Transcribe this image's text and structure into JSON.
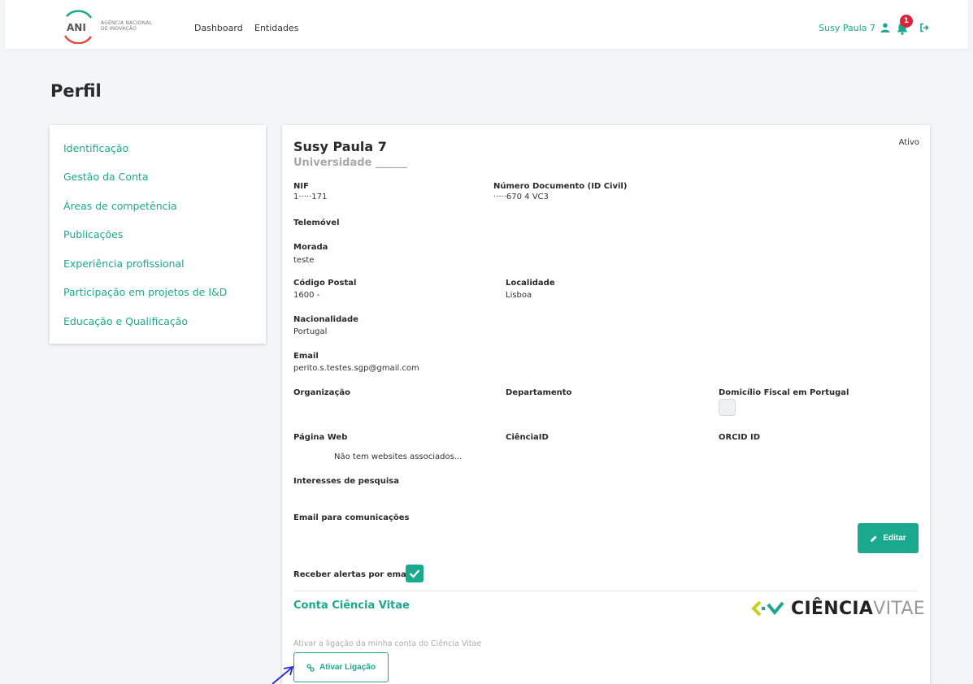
{
  "navbar": {
    "logo_text": "ANI",
    "logo_subtitle_line1": "AGÊNCIA NACIONAL",
    "logo_subtitle_line2": "DE INOVAÇÃO",
    "links": [
      "Dashboard",
      "Entidades"
    ],
    "user_name": "Susy Paula 7",
    "notification_count": "1",
    "icons": [
      "user-icon",
      "bell-icon",
      "logout-icon"
    ]
  },
  "page": {
    "title": "Perfil"
  },
  "menu": {
    "items": [
      "Identificação",
      "Gestão da Conta",
      "Áreas de competência",
      "Publicações",
      "Experiência profissional",
      "Participação em projetos de I&D",
      "Educação e Qualificação"
    ]
  },
  "profile": {
    "name": "Susy Paula 7",
    "organization": "Universidade ______",
    "status": "Ativo",
    "nif_label": "NIF",
    "nif_value": "1·····171",
    "doc_label": "Número Documento (ID Civil)",
    "doc_value": "·····670 4 VC3",
    "phone_label": "Telemóvel",
    "address_label": "Morada",
    "address_value": "teste",
    "postal_label": "Código Postal",
    "postal_value": "1600 -",
    "locality_label": "Localidade",
    "locality_value": "Lisboa",
    "nationality_label": "Nacionalidade",
    "nationality_value": "Portugal",
    "email_label": "Email",
    "email_value": "perito.s.testes.sgp@gmail.com",
    "organization_label": "Organização",
    "department_label": "Departamento",
    "tax_label": "Domicílio Fiscal em Portugal",
    "web_label": "Página Web",
    "web_empty": "Não tem websites associados...",
    "ciencia_label": "CiênciaID",
    "orcid_label": "ORCID ID",
    "interests_label": "Interesses de pesquisa",
    "comm_email_label": "Email para comunicações",
    "edit_button": "Editar",
    "alerts_label": "Receber alertas por email"
  },
  "ciencia_vitae": {
    "section_title": "Conta Ciência Vitae",
    "logo_bold": "CIÊNCIA",
    "logo_light": "VITAE",
    "hint": "Ativar a ligação da minha conta do Ciência Vitae",
    "button": "Ativar Ligação"
  },
  "colors": {
    "accent": "#1aa98e",
    "badge": "#d9243d",
    "logo_red": "#e04a3f"
  }
}
